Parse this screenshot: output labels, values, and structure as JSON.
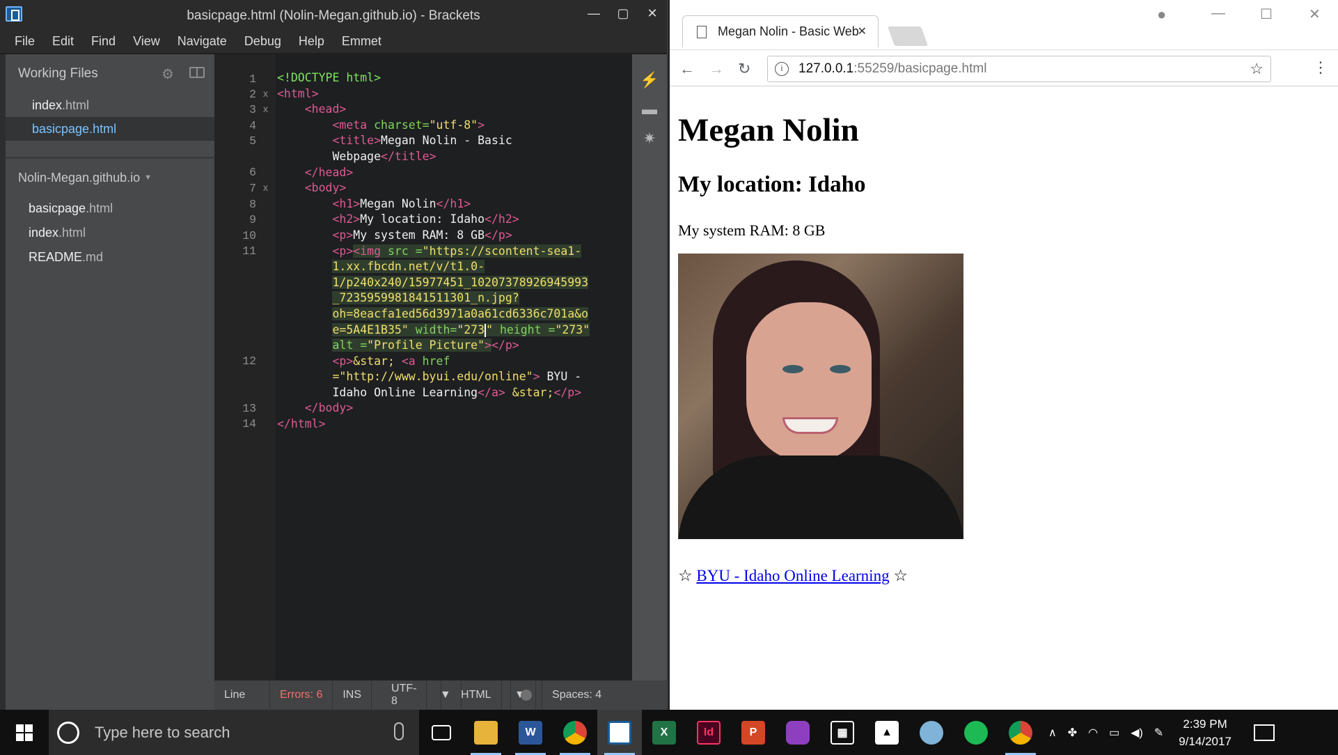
{
  "brackets": {
    "title": "basicpage.html (Nolin-Megan.github.io) - Brackets",
    "min": "—",
    "max": "▢",
    "close": "✕",
    "menu": [
      "File",
      "Edit",
      "Find",
      "View",
      "Navigate",
      "Debug",
      "Help",
      "Emmet"
    ],
    "working_files_label": "Working Files",
    "working_files": [
      {
        "name": "index",
        "ext": ".html"
      },
      {
        "name": "basicpage",
        "ext": ".html"
      }
    ],
    "project_name": "Nolin-Megan.github.io",
    "project_files": [
      {
        "name": "basicpage",
        "ext": ".html"
      },
      {
        "name": "index",
        "ext": ".html"
      },
      {
        "name": "README",
        "ext": ".md"
      }
    ],
    "line_numbers": [
      "1",
      "2",
      "3",
      "4",
      "5",
      "6",
      "7",
      "8",
      "9",
      "10",
      "11",
      "12",
      "13",
      "14"
    ],
    "status": {
      "line": "Line",
      "errors": "Errors: 6",
      "ins": "INS",
      "encoding": "UTF-8",
      "language": "HTML",
      "spaces": "Spaces: 4"
    }
  },
  "code": {
    "l1": "<!DOCTYPE html>",
    "html_open": "<html>",
    "head_open": "<head>",
    "meta_t": "<meta",
    "charset_a": "charset=",
    "utf8": "\"utf-8\"",
    "gt": ">",
    "title_open": "<title>",
    "title_text1": "Megan Nolin - Basic",
    "title_text2": "Webpage",
    "title_close": "</title>",
    "head_close": "</head>",
    "body_open": "<body>",
    "h1_open": "<h1>",
    "h1_text": "Megan Nolin",
    "h1_close": "</h1>",
    "h2_open": "<h2>",
    "h2_text": "My location: Idaho",
    "h2_close": "</h2>",
    "p_open": "<p>",
    "ram_text": "My system RAM: 8 GB",
    "p_close": "</p>",
    "img_t": "<img",
    "src_a": "src =",
    "src1": "\"https://scontent-sea1-",
    "src2": "1.xx.fbcdn.net/v/t1.0-",
    "src3": "1/p240x240/15977451_10207378926945993",
    "src4": "_7235959981841511301_n.jpg?",
    "src5a": "oh=8eacfa1ed56d3971a0a61cd6336c701a&o",
    "src5b": "e=5A4E1B35\"",
    "width_a": "width=",
    "width_v1": "\"273",
    "width_v2": "\"",
    "height_a": "height =",
    "height_v": "\"273\"",
    "alt_a": "alt =",
    "alt_v": "\"Profile Picture\"",
    "star_ent": "&star;",
    "a_t": "<a",
    "href_a": "href",
    "href_v": "=\"http://www.byui.edu/online\"",
    "link_text1": "BYU -",
    "link_text2": "Idaho Online Learning",
    "a_close": "</a>",
    "body_close": "</body>",
    "html_close": "</html>"
  },
  "chrome": {
    "tab_title": "Megan Nolin - Basic Web",
    "url_host": "127.0.0.1",
    "url_path": ":55259/basicpage.html"
  },
  "page": {
    "h1": "Megan Nolin",
    "h2": "My location: Idaho",
    "ram": "My system RAM: 8 GB",
    "star": "☆",
    "link": "BYU - Idaho Online Learning",
    "img_alt": "Profile Picture"
  },
  "taskbar": {
    "search_placeholder": "Type here to search",
    "time": "2:39 PM",
    "date": "9/14/2017",
    "apps": [
      {
        "name": "task-view",
        "label": "",
        "color": "#101010"
      },
      {
        "name": "file-explorer",
        "label": "",
        "color": "#e8b33a"
      },
      {
        "name": "word",
        "label": "W",
        "color": "#2b579a"
      },
      {
        "name": "chrome",
        "label": "",
        "color": "#db4437"
      },
      {
        "name": "brackets",
        "label": "",
        "color": "#1a5c96"
      },
      {
        "name": "excel",
        "label": "X",
        "color": "#217346"
      },
      {
        "name": "indesign",
        "label": "Id",
        "color": "#49021f"
      },
      {
        "name": "powerpoint",
        "label": "P",
        "color": "#d24726"
      },
      {
        "name": "picsart",
        "label": "",
        "color": "#8e3fbf"
      },
      {
        "name": "calculator",
        "label": "",
        "color": "#2a2a2a"
      },
      {
        "name": "photos",
        "label": "",
        "color": "#2a2a2a"
      },
      {
        "name": "paint",
        "label": "",
        "color": "#2a2a2a"
      },
      {
        "name": "spotify",
        "label": "",
        "color": "#1db954"
      },
      {
        "name": "chrome-2",
        "label": "",
        "color": "#db4437"
      }
    ]
  }
}
